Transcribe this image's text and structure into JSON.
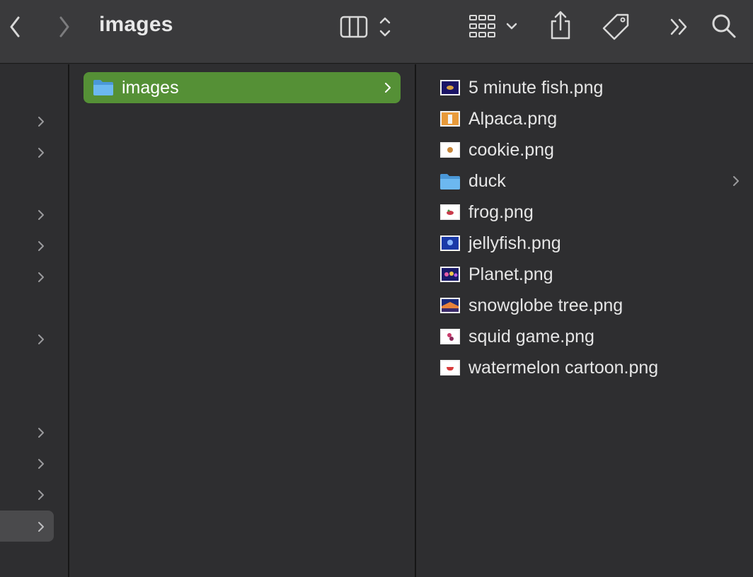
{
  "window": {
    "title": "images"
  },
  "toolbar": {
    "back_icon": "chevron-left-icon",
    "forward_icon": "chevron-right-icon",
    "view_icon": "column-view-icon",
    "group_icon": "grid-group-icon",
    "share_icon": "share-icon",
    "tag_icon": "tag-icon",
    "more_icon": "double-chevron-icon",
    "search_icon": "search-icon"
  },
  "column2": {
    "selected_item": "images"
  },
  "column3": {
    "items": [
      {
        "label": "5 minute fish.png",
        "kind": "image"
      },
      {
        "label": "Alpaca.png",
        "kind": "image"
      },
      {
        "label": "cookie.png",
        "kind": "image"
      },
      {
        "label": "duck",
        "kind": "folder"
      },
      {
        "label": "frog.png",
        "kind": "image"
      },
      {
        "label": "jellyfish.png",
        "kind": "image"
      },
      {
        "label": "Planet.png",
        "kind": "image"
      },
      {
        "label": "snowglobe tree.png",
        "kind": "image"
      },
      {
        "label": "squid game.png",
        "kind": "image"
      },
      {
        "label": "watermelon cartoon.png",
        "kind": "image"
      }
    ]
  },
  "colors": {
    "selection": "#559036",
    "folder": "#5aa7e6",
    "background": "#2e2e30",
    "toolbar": "#3a3a3c"
  }
}
